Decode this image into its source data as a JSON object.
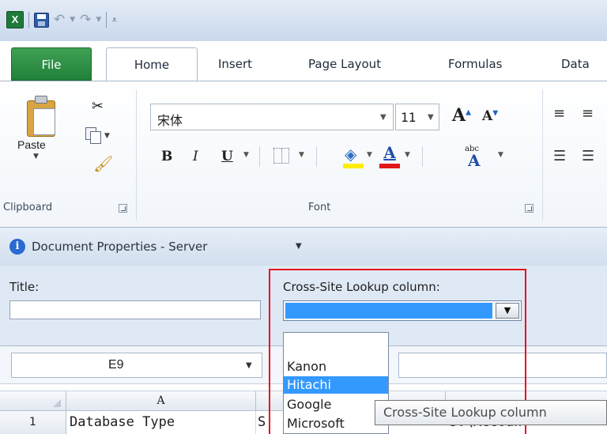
{
  "colors": {
    "file_tab": "#21803a",
    "selection": "#3399ff",
    "highlight_box": "#e8101d",
    "fill_color": "#ffee00",
    "font_color": "#e01818"
  },
  "quick_access": {
    "app_icon": "excel-icon",
    "save_icon": "save-icon",
    "undo_icon": "undo-icon",
    "redo_icon": "redo-icon"
  },
  "tabs": [
    "File",
    "Home",
    "Insert",
    "Page Layout",
    "Formulas",
    "Data"
  ],
  "ribbon": {
    "clipboard": {
      "paste_label": "Paste",
      "group_label": "Clipboard"
    },
    "font": {
      "font_name": "宋体",
      "font_size": "11",
      "bold": "B",
      "italic": "I",
      "underline": "U",
      "grow": "A",
      "shrink": "A",
      "font_color": "A",
      "phonetic_small": "abc",
      "phonetic_big": "A",
      "group_label": "Font"
    }
  },
  "doc_panel": {
    "title": "Document Properties - Server",
    "title_field_label": "Title:",
    "title_field_value": "",
    "lookup_label": "Cross-Site Lookup column:",
    "lookup_value": "",
    "dropdown_options": [
      "",
      "Kanon",
      "Hitachi",
      "Google",
      "Microsoft"
    ],
    "selected_option": "Hitachi"
  },
  "formula_bar": {
    "name_box": "E9",
    "formula": ""
  },
  "grid": {
    "column_a": "A",
    "row_1": "1",
    "cell_a1": "Database Type",
    "cell_b1": "S",
    "cell_c1": "\"S:\\Accoun"
  },
  "tooltip": "Cross-Site Lookup column"
}
